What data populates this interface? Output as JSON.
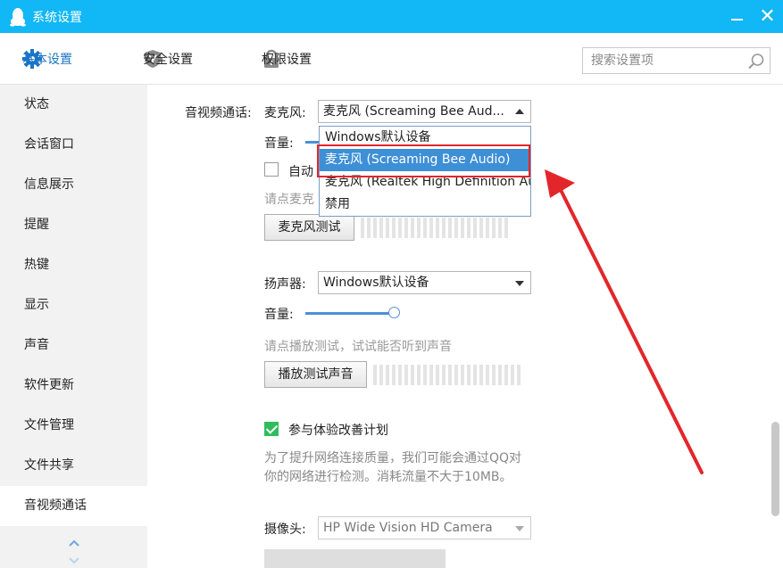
{
  "window": {
    "title": "系统设置"
  },
  "toolbar": {
    "tabs": [
      {
        "label": "基本设置",
        "active": true
      },
      {
        "label": "安全设置",
        "active": false
      },
      {
        "label": "权限设置",
        "active": false
      }
    ],
    "search_placeholder": "搜索设置项"
  },
  "sidebar": {
    "items": [
      {
        "label": "状态"
      },
      {
        "label": "会话窗口"
      },
      {
        "label": "信息展示"
      },
      {
        "label": "提醒"
      },
      {
        "label": "热键"
      },
      {
        "label": "显示"
      },
      {
        "label": "声音"
      },
      {
        "label": "软件更新"
      },
      {
        "label": "文件管理"
      },
      {
        "label": "文件共享"
      },
      {
        "label": "音视频通话",
        "active": true
      }
    ]
  },
  "av": {
    "section_label": "音视频通话:",
    "mic": {
      "label": "麦克风:",
      "selected": "麦克风 (Screaming Bee Aud...",
      "volume_label": "音量:",
      "auto_label": "自动",
      "hint": "请点麦克",
      "test_button": "麦克风测试",
      "options": [
        "Windows默认设备",
        "麦克风 (Screaming Bee Audio)",
        "麦克风 (Realtek High Definition Audio)",
        "禁用"
      ],
      "highlighted_option": "麦克风 (Screaming Bee Audio)"
    },
    "speaker": {
      "label": "扬声器:",
      "selected": "Windows默认设备",
      "volume_label": "音量:",
      "volume": 0.93,
      "hint": "请点播放测试，试试能否听到声音",
      "test_button": "播放测试声音"
    },
    "experience": {
      "label": "参与体验改善计划",
      "checked": true,
      "desc_line1": "为了提升网络连接质量，我们可能会通过QQ对",
      "desc_line2": "你的网络进行检测。消耗流量不大于10MB。"
    },
    "camera": {
      "label": "摄像头:",
      "selected": "HP Wide Vision HD Camera"
    }
  },
  "colors": {
    "titlebar": "#12b7f5",
    "accent": "#1b74c5",
    "selection": "#3d8fd6",
    "annotation": "#e3262b",
    "checkbox": "#2fbd5c"
  }
}
